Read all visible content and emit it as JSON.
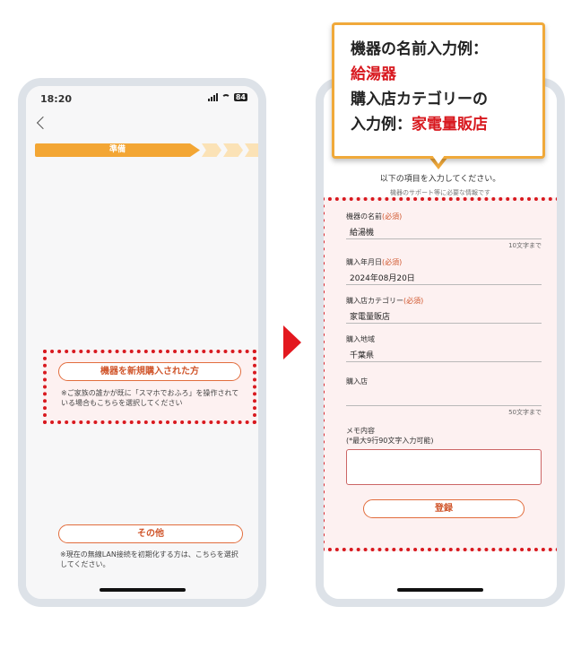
{
  "left_phone": {
    "status_time": "18:20",
    "battery": "84",
    "step_label": "準備",
    "new_purchase_button": "機器を新規購入された方",
    "new_purchase_note": "※ご家族の誰かが既に「スマホでおふろ」を操作されている場合もこちらを選択してください",
    "other_button": "その他",
    "other_note": "※現在の無線LAN接続を初期化する方は、こちらを選択してください。"
  },
  "right_phone": {
    "intro": "以下の項目を入力してください。",
    "intro_sub": "機器のサポート等に必要な情報です",
    "required_mark": "(必須)",
    "fields": {
      "device_name_label": "機器の名前",
      "device_name_value": "給湯機",
      "device_name_counter": "10文字まで",
      "purchase_date_label": "購入年月日",
      "purchase_date_value": "2024年08月20日",
      "store_category_label": "購入店カテゴリー",
      "store_category_value": "家電量販店",
      "area_label": "購入地域",
      "area_value": "千葉県",
      "store_label": "購入店",
      "store_value": "",
      "store_counter": "50文字まで",
      "memo_label": "メモ内容",
      "memo_hint": "(*最大9行90文字入力可能)"
    },
    "register_button": "登録"
  },
  "callout": {
    "line1": "機器の名前入力例：",
    "line2": "給湯器",
    "line3": "購入店カテゴリーの",
    "line4_prefix": "入力例：",
    "line4_red": "家電量販店"
  },
  "colors": {
    "accent_orange": "#f3a634",
    "highlight_red": "#d8191f",
    "button_text": "#d0552b"
  }
}
